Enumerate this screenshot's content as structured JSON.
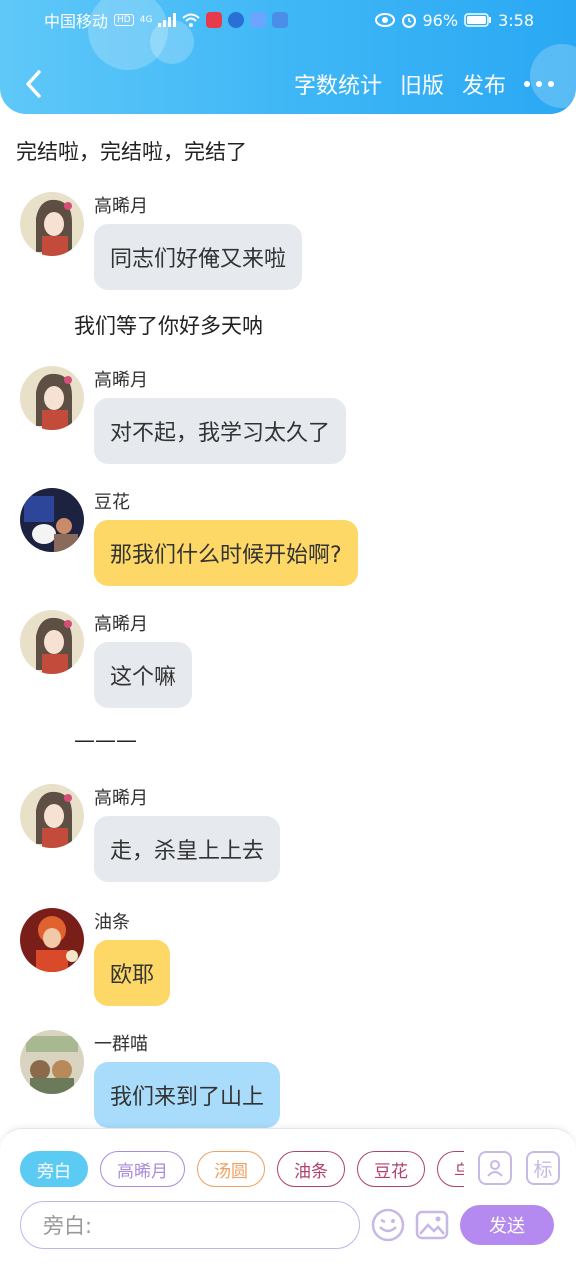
{
  "status_bar": {
    "carrier": "中国移动",
    "network": "4G",
    "battery": "96%",
    "time": "3:58"
  },
  "nav": {
    "back_icon": "chevron-left-icon",
    "word_count": "字数统计",
    "old_version": "旧版",
    "publish": "发布",
    "more_icon": "more-dots-icon"
  },
  "chat": {
    "narration_1": "完结啦，完结啦，完结了",
    "narration_2": "我们等了你好多天呐",
    "narration_3": "———",
    "messages": [
      {
        "name": "高晞月",
        "text": "同志们好俺又来啦",
        "style": "gray"
      },
      {
        "name": "高晞月",
        "text": "对不起，我学习太久了",
        "style": "gray"
      },
      {
        "name": "豆花",
        "text": "那我们什么时候开始啊?",
        "style": "yellow"
      },
      {
        "name": "高晞月",
        "text": "这个嘛",
        "style": "gray"
      },
      {
        "name": "高晞月",
        "text": "走，杀皇上上去",
        "style": "gray"
      },
      {
        "name": "油条",
        "text": "欧耶",
        "style": "yellow"
      },
      {
        "name": "一群喵",
        "text": "我们来到了山上",
        "style": "blue"
      }
    ]
  },
  "roles": {
    "chips": [
      {
        "label": "旁白",
        "color": "#5ccbf4"
      },
      {
        "label": "高晞月",
        "color": "#a98bdc"
      },
      {
        "label": "汤圆",
        "color": "#f0a060"
      },
      {
        "label": "油条",
        "color": "#b04070"
      },
      {
        "label": "豆花",
        "color": "#b04070"
      },
      {
        "label": "乌",
        "color": "#b04070"
      }
    ],
    "person_icon": "person-icon",
    "tag_icon_label": "标"
  },
  "composer": {
    "placeholder": "旁白:",
    "send": "发送",
    "emoji_icon": "emoji-icon",
    "image_icon": "image-icon"
  },
  "colors": {
    "header": "#3fb7f6",
    "bubble_gray": "#e6eaef",
    "bubble_yellow": "#fdd866",
    "bubble_blue": "#a9dcfb",
    "send_button": "#b58af0"
  }
}
